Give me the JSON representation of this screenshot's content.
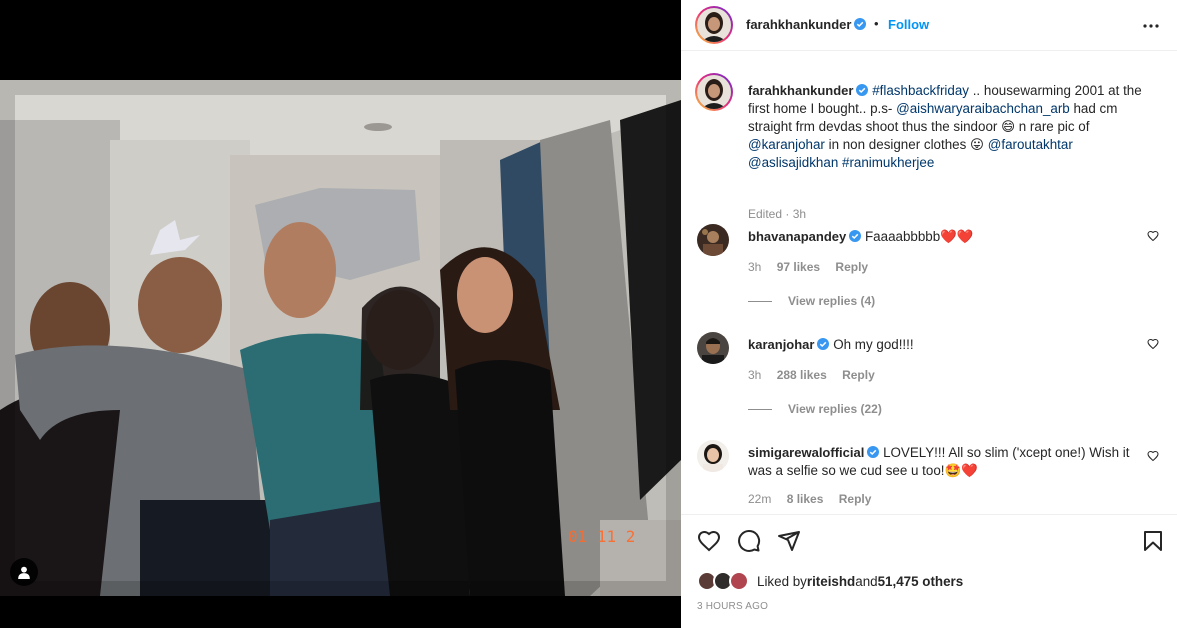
{
  "post": {
    "author": "farahkhankunder",
    "separator": "•",
    "follow_label": "Follow",
    "more_icon": "more-horizontal-icon"
  },
  "caption": {
    "username": "farahkhankunder",
    "parts": [
      {
        "t": "#flashbackfriday",
        "tag": true
      },
      {
        "t": " .. housewarming 2001 at the first home I bought.. p.s- ",
        "tag": false
      },
      {
        "t": "@aishwaryaraibachchan_arb",
        "tag": true
      },
      {
        "t": " had cm straight frm devdas shoot thus the sindoor ",
        "tag": false
      },
      {
        "t": "😄",
        "tag": false
      },
      {
        "t": " n rare pic of ",
        "tag": false
      },
      {
        "t": "@karanjohar",
        "tag": true
      },
      {
        "t": " in non designer clothes ",
        "tag": false
      },
      {
        "t": "😛",
        "tag": false
      },
      {
        "t": " ",
        "tag": false
      },
      {
        "t": "@faroutakhtar",
        "tag": true
      },
      {
        "t": " ",
        "tag": false
      },
      {
        "t": "@aslisajidkhan",
        "tag": true
      },
      {
        "t": " ",
        "tag": false
      },
      {
        "t": "#ranimukherjee",
        "tag": true
      }
    ],
    "meta": "Edited · 3h"
  },
  "comments": [
    {
      "username": "bhavanapandey",
      "text": "Faaaabbbbb❤️❤️",
      "time": "3h",
      "likes": "97 likes",
      "reply": "Reply",
      "view_replies": "View replies (4)"
    },
    {
      "username": "karanjohar",
      "text": "Oh my god!!!!",
      "time": "3h",
      "likes": "288 likes",
      "reply": "Reply",
      "view_replies": "View replies (22)"
    },
    {
      "username": "simigarewalofficial",
      "text": "LOVELY!!! All so slim ('xcept one!) Wish it was a selfie so we cud see u too!🤩❤️",
      "time": "22m",
      "likes": "8 likes",
      "reply": "Reply",
      "view_replies": ""
    }
  ],
  "likes": {
    "prefix": "Liked by ",
    "user": "riteishd",
    "middle": " and ",
    "count": "51,475 others"
  },
  "time_ago": "3 HOURS AGO",
  "photo": {
    "date_stamp": "01 11 2"
  },
  "colors": {
    "link": "#00376b",
    "follow": "#0095f6",
    "verified": "#3897f0",
    "muted": "#8e8e8e",
    "like": "#ed4956"
  }
}
